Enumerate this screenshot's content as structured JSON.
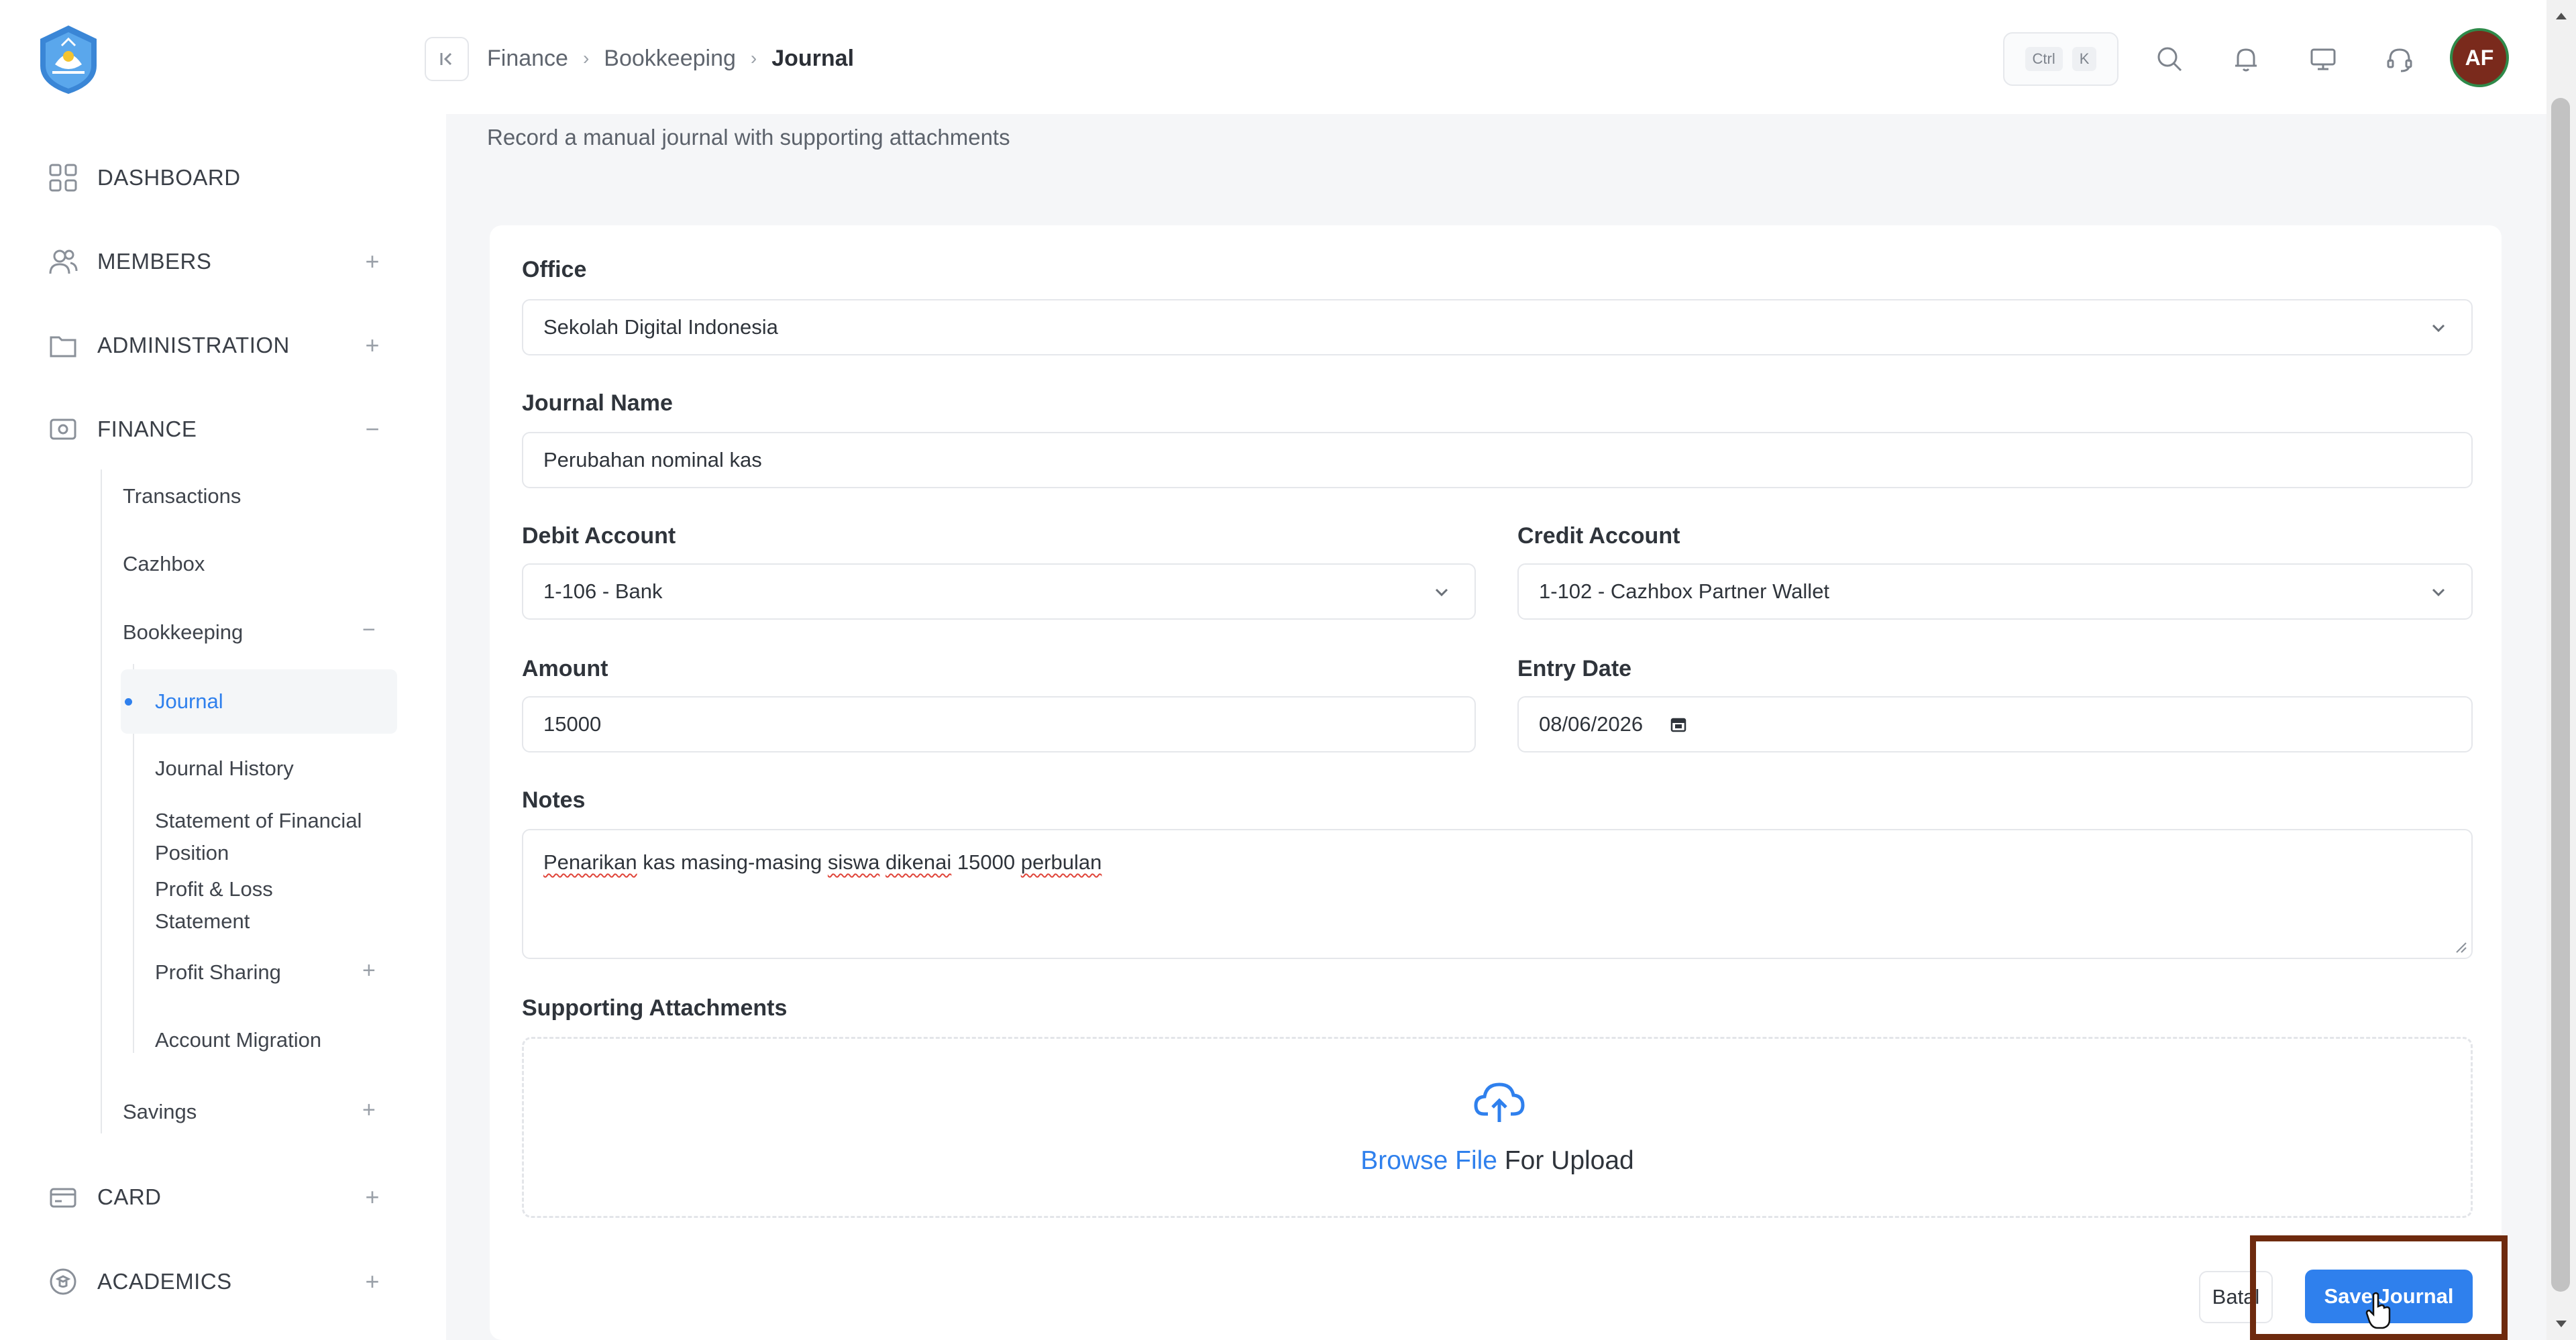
{
  "sidebar": {
    "logo_icon": "tut-wuri-handayani-logo-icon",
    "items": [
      {
        "label": "DASHBOARD",
        "icon": "grid-icon"
      },
      {
        "label": "MEMBERS",
        "icon": "users-icon",
        "toggle": "+"
      },
      {
        "label": "ADMINISTRATION",
        "icon": "folder-icon",
        "toggle": "+"
      },
      {
        "label": "FINANCE",
        "icon": "wallet-icon",
        "toggle": "−"
      },
      {
        "label": "CARD",
        "icon": "card-icon",
        "toggle": "+"
      },
      {
        "label": "ACADEMICS",
        "icon": "academics-icon",
        "toggle": "+"
      }
    ],
    "finance_sub": {
      "transactions": "Transactions",
      "cazhbox": "Cazhbox",
      "bookkeeping": "Bookkeeping",
      "bookkeeping_toggle": "−",
      "savings": "Savings",
      "savings_toggle": "+"
    },
    "bookkeeping_sub": {
      "journal": "Journal",
      "journal_history": "Journal History",
      "sofp_line1": "Statement of Financial",
      "sofp_line2": "Position",
      "pl_line1": "Profit & Loss",
      "pl_line2": "Statement",
      "profit_sharing": "Profit Sharing",
      "profit_sharing_toggle": "+",
      "account_migration": "Account Migration"
    }
  },
  "topbar": {
    "breadcrumb": [
      "Finance",
      "Bookkeeping",
      "Journal"
    ],
    "kbd": [
      "Ctrl",
      "K"
    ],
    "icons": [
      "search-icon",
      "bell-icon",
      "monitor-icon",
      "headset-icon"
    ],
    "avatar_initials": "AF"
  },
  "page": {
    "subtitle": "Record a manual journal with supporting attachments"
  },
  "form": {
    "office": {
      "label": "Office",
      "value": "Sekolah Digital Indonesia"
    },
    "journal_name": {
      "label": "Journal Name",
      "value": "Perubahan nominal kas"
    },
    "debit_account": {
      "label": "Debit Account",
      "value": "1-106 - Bank"
    },
    "credit_account": {
      "label": "Credit Account",
      "value": "1-102 - Cazhbox Partner Wallet"
    },
    "amount": {
      "label": "Amount",
      "value": "15000"
    },
    "entry_date": {
      "label": "Entry Date",
      "value": "08/06/2026"
    },
    "notes": {
      "label": "Notes",
      "w1": "Penarikan",
      "w2": " kas masing-masing ",
      "w3": "siswa",
      "w4": " ",
      "w5": "dikenai",
      "w6": " 15000 ",
      "w7": "perbulan"
    },
    "attachments": {
      "label": "Supporting Attachments",
      "browse": "Browse File",
      "rest": " For Upload"
    },
    "cancel_label": "Batal",
    "save_label": "Save Journal"
  },
  "colors": {
    "accent": "#2f80ed",
    "highlight": "#6e2a0e"
  }
}
